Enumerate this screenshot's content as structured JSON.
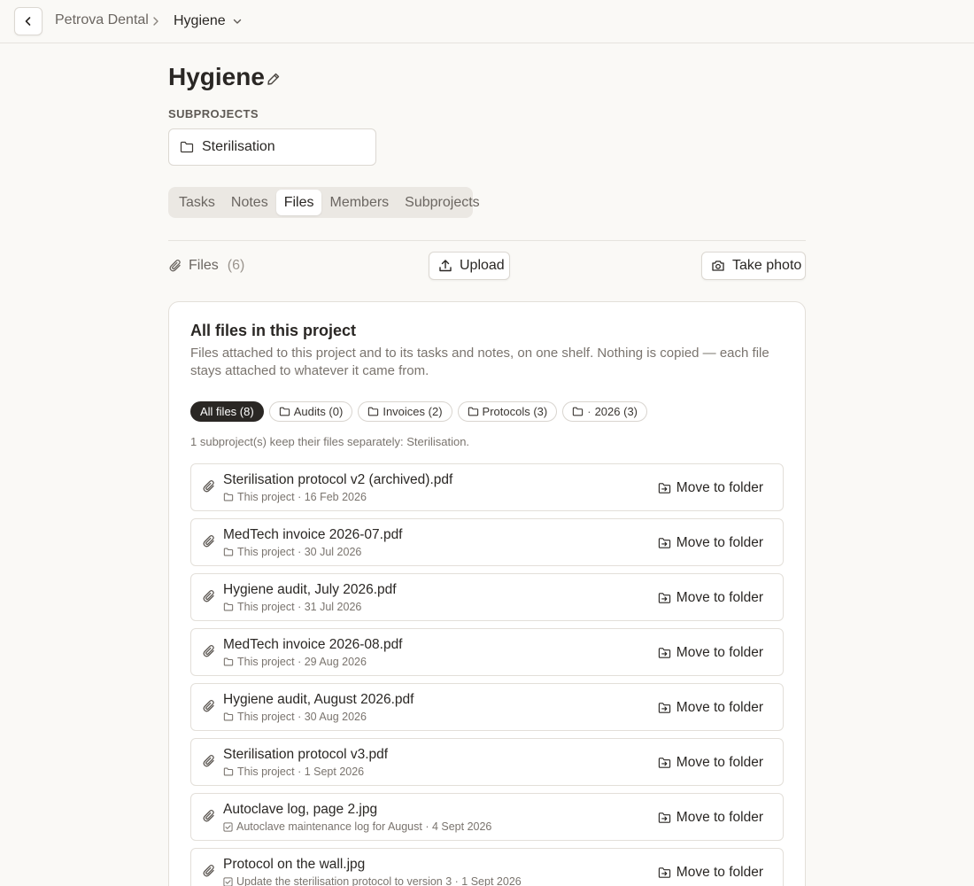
{
  "topbar": {
    "breadcrumb_parent": "Petrova Dental",
    "breadcrumb_current": "Hygiene"
  },
  "page": {
    "title": "Hygiene",
    "subprojects_label": "SUBPROJECTS",
    "subprojects": [
      "Sterilisation"
    ]
  },
  "tabs": [
    {
      "label": "Tasks",
      "active": false
    },
    {
      "label": "Notes",
      "active": false
    },
    {
      "label": "Files",
      "active": true
    },
    {
      "label": "Members",
      "active": false
    },
    {
      "label": "Subprojects",
      "active": false
    }
  ],
  "files_header": {
    "label": "Files",
    "count": "(6)",
    "upload_label": "Upload",
    "photo_label": "Take photo"
  },
  "panel": {
    "title": "All files in this project",
    "description": "Files attached to this project and to its tasks and notes, on one shelf. Nothing is copied — each file stays attached to whatever it came from.",
    "subproject_note": "1 subproject(s) keep their files separately: Sterilisation."
  },
  "chips": [
    {
      "label": "All files (8)",
      "active": true,
      "folder": false
    },
    {
      "label": "Audits (0)",
      "active": false,
      "folder": true
    },
    {
      "label": "Invoices (2)",
      "active": false,
      "folder": true
    },
    {
      "label": "Protocols (3)",
      "active": false,
      "folder": true
    },
    {
      "label": "2026 (3)",
      "active": false,
      "folder": true,
      "prefix": "·"
    }
  ],
  "files": [
    {
      "name": "Sterilisation protocol v2 (archived).pdf",
      "meta": "This project · 16 Feb 2026",
      "source": "folder"
    },
    {
      "name": "MedTech invoice 2026-07.pdf",
      "meta": "This project · 30 Jul 2026",
      "source": "folder"
    },
    {
      "name": "Hygiene audit, July 2026.pdf",
      "meta": "This project · 31 Jul 2026",
      "source": "folder"
    },
    {
      "name": "MedTech invoice 2026-08.pdf",
      "meta": "This project · 29 Aug 2026",
      "source": "folder"
    },
    {
      "name": "Hygiene audit, August 2026.pdf",
      "meta": "This project · 30 Aug 2026",
      "source": "folder"
    },
    {
      "name": "Sterilisation protocol v3.pdf",
      "meta": "This project · 1 Sept 2026",
      "source": "folder"
    },
    {
      "name": "Autoclave log, page 2.jpg",
      "meta": "Autoclave maintenance log for August · 4 Sept 2026",
      "source": "task"
    },
    {
      "name": "Protocol on the wall.jpg",
      "meta": "Update the sterilisation protocol to version 3 · 1 Sept 2026",
      "source": "task"
    }
  ],
  "move_label": "Move to folder",
  "icons": {
    "back": "chevron-left-icon",
    "separator": "chevron-right-icon",
    "dropdown": "chevron-down-icon",
    "edit": "pencil-icon",
    "folder": "folder-icon",
    "paperclip": "paperclip-icon",
    "upload": "upload-icon",
    "camera": "camera-icon",
    "move": "folder-move-icon",
    "task": "checkbox-icon"
  }
}
